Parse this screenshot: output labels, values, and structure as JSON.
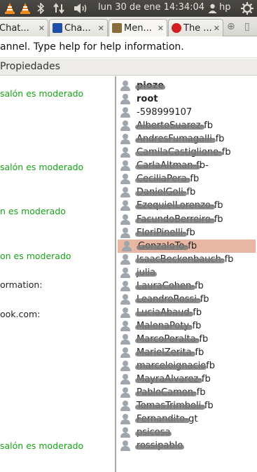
{
  "panel": {
    "clock": "lun 30 de ene 14:34:04",
    "user": "hp",
    "icons": [
      "vlc-icon",
      "vlc-icon",
      "bluetooth-icon",
      "network-arrows-icon",
      "volume-icon",
      "power-icon"
    ]
  },
  "tabs": [
    {
      "label": "Chat...",
      "favicon_color": "#f0e9c8",
      "active": false
    },
    {
      "label": "Cha...",
      "favicon_color": "#1f4fa8",
      "active": false
    },
    {
      "label": "Men...",
      "favicon_color": "#8a6d3b",
      "active": true
    },
    {
      "label": "The ...",
      "favicon_color": "#d21f1f",
      "active": false
    }
  ],
  "topic": "annel. Type help for help information.",
  "menu": {
    "propiedades": "Propiedades"
  },
  "chat": {
    "messages": [
      {
        "text": "salón es moderado",
        "kind": "mod"
      },
      {
        "text": "salón es moderado",
        "kind": "mod"
      },
      {
        "text": "n es moderado",
        "kind": "mod"
      },
      {
        "text": "on es moderado",
        "kind": "mod"
      },
      {
        "text": "ormation:",
        "kind": "plain"
      },
      {
        "text": "ook.com:",
        "kind": "plain"
      },
      {
        "text": "salón es moderado",
        "kind": "mod"
      }
    ]
  },
  "users": [
    {
      "nick": "pioze",
      "bold": true,
      "redacted": true,
      "full": true
    },
    {
      "nick": "root",
      "bold": true,
      "redacted": false
    },
    {
      "nick": "-598999107",
      "bold": false,
      "redacted": false
    },
    {
      "nick": "AlbertoSuarez-fb",
      "redacted": true
    },
    {
      "nick": "AndresFumagalli-fb",
      "redacted": true
    },
    {
      "nick": "CamilaCastiglione-fb",
      "redacted": true
    },
    {
      "nick": "CarlaAltman-fb-",
      "redacted": true
    },
    {
      "nick": "CeciliaPera-fb",
      "redacted": true
    },
    {
      "nick": "DanielGoli-fb",
      "redacted": true
    },
    {
      "nick": "EzequielLorenzo-fb",
      "redacted": true
    },
    {
      "nick": "FacundoBerreiro-fb",
      "redacted": true
    },
    {
      "nick": "FloriPinelli-fb",
      "redacted": true
    },
    {
      "nick": "GonzaloTo-fb",
      "redacted": true,
      "selected": true
    },
    {
      "nick": "IsaacBeckenbauch-fb",
      "redacted": true
    },
    {
      "nick": "julia",
      "redacted": true,
      "full": true
    },
    {
      "nick": "LauraCohen-fb",
      "redacted": true
    },
    {
      "nick": "LeandroRossi-fb",
      "redacted": true
    },
    {
      "nick": "LuciaAbaud-fb",
      "redacted": true
    },
    {
      "nick": "MalenaPoty-fb",
      "redacted": true
    },
    {
      "nick": "MarcoPeralta-fb",
      "redacted": true
    },
    {
      "nick": "MarielZerita-fb",
      "redacted": true
    },
    {
      "nick": "marceloignaciofb",
      "redacted": true
    },
    {
      "nick": "MayraAlvarez-fb",
      "redacted": true
    },
    {
      "nick": "PabloCamon-fb",
      "redacted": true
    },
    {
      "nick": "TomasTrimboli-fb",
      "redacted": true
    },
    {
      "nick": "Fernandito-gt",
      "redacted": true
    },
    {
      "nick": "psicosa",
      "redacted": true,
      "full": true
    },
    {
      "nick": "rossipablo",
      "redacted": true,
      "full": true
    }
  ]
}
